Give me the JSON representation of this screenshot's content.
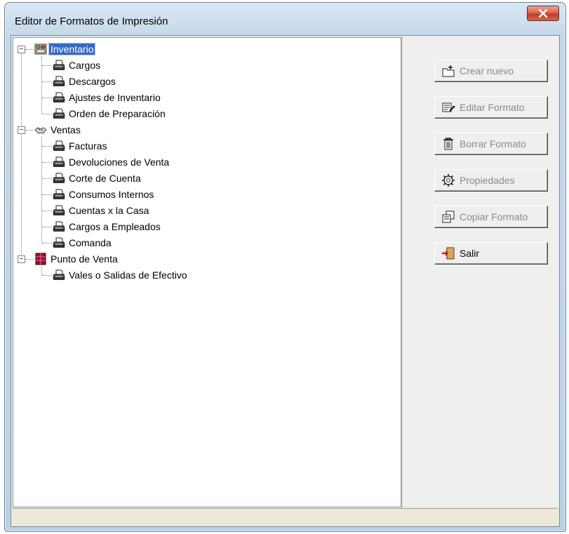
{
  "window": {
    "title": "Editor de Formatos de Impresión"
  },
  "tree": {
    "groups": [
      {
        "label": "Inventario",
        "selected": true,
        "icon": "inventory-icon",
        "items": [
          "Cargos",
          "Descargos",
          "Ajustes de Inventario",
          "Orden de Preparación"
        ]
      },
      {
        "label": "Ventas",
        "selected": false,
        "icon": "handshake-icon",
        "items": [
          "Facturas",
          "Devoluciones de Venta",
          "Corte de Cuenta",
          "Consumos Internos",
          "Cuentas x la Casa",
          "Cargos a Empleados",
          "Comanda"
        ]
      },
      {
        "label": "Punto de Venta",
        "selected": false,
        "icon": "point-of-sale-icon",
        "items": [
          "Vales o Salidas de Efectivo"
        ]
      }
    ],
    "item_icon": "printer-icon"
  },
  "buttons": [
    {
      "label": "Crear nuevo",
      "enabled": false,
      "icon": "new-folder-icon"
    },
    {
      "label": "Editar Formato",
      "enabled": false,
      "icon": "edit-icon"
    },
    {
      "label": "Borrar Formato",
      "enabled": false,
      "icon": "trash-icon"
    },
    {
      "label": "Propiedades",
      "enabled": false,
      "icon": "properties-gear-icon"
    },
    {
      "label": "Copiar Formato",
      "enabled": false,
      "icon": "copy-icon"
    },
    {
      "label": "Salir",
      "enabled": true,
      "icon": "exit-door-icon"
    }
  ],
  "colors": {
    "selection": "#3169c6",
    "close_button": "#c23a20",
    "disabled_text": "#8a8a8a"
  }
}
